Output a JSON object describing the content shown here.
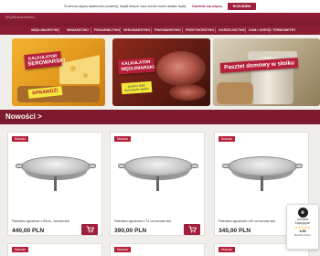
{
  "cookie": {
    "text": "Ta strona używa ciasteczek (cookies), dzięki którym nasz serwis może działać lepiej.",
    "more": "Dowiedz się więcej",
    "close": "ROZUMIEM"
  },
  "header": {
    "logo": "Wędliniarstwo"
  },
  "nav": {
    "items": [
      "WĘDLINIARSTWO",
      "WINIARSTWO",
      "PIEKARNICTWO",
      "SEROWARSTWO",
      "PIWOWARSTWO",
      "PRZETWÓRSTWO",
      "GORZELNICTWO",
      "DOM I OGRÓD",
      "TERMOMETRY"
    ]
  },
  "banners": [
    {
      "line1": "KALKULATOR",
      "line2": "SEROWARSKI",
      "tag": "SPRAWDŹ!"
    },
    {
      "line1": "KALKULATOR",
      "line2": "WĘDLINIARSKI",
      "sub1": "przelicz ilość",
      "sub2": "domowych wędlin"
    },
    {
      "caption": "Pasztet domowy w słoiku"
    }
  ],
  "section": {
    "title": "Nowości >"
  },
  "products": [
    {
      "badge": "Nowość",
      "name": "Palenisko ogrodowe o 80cm - surowa stal",
      "price": "440,00 PLN"
    },
    {
      "badge": "Nowość",
      "name": "Palenisko ogrodowe o 70 cm surowa stal",
      "price": "390,00 PLN"
    },
    {
      "badge": "Nowość",
      "name": "Palenisko ogrodowe o 60 cm surowa stal",
      "price": "345,00 PLN"
    }
  ],
  "next_row": [
    {
      "badge": "Nowość"
    },
    {
      "badge": "Nowość"
    },
    {
      "badge": "Nowość"
    }
  ],
  "trust": {
    "seal": "e",
    "line1": "Ochrona",
    "line2": "Kupujących",
    "stars": "★★★★★",
    "score": "4.93",
    "rating": "Bardzo dobry"
  },
  "colors": {
    "brand": "#8a1c33",
    "accent": "#a01f3c",
    "badge": "#b51f3a"
  }
}
